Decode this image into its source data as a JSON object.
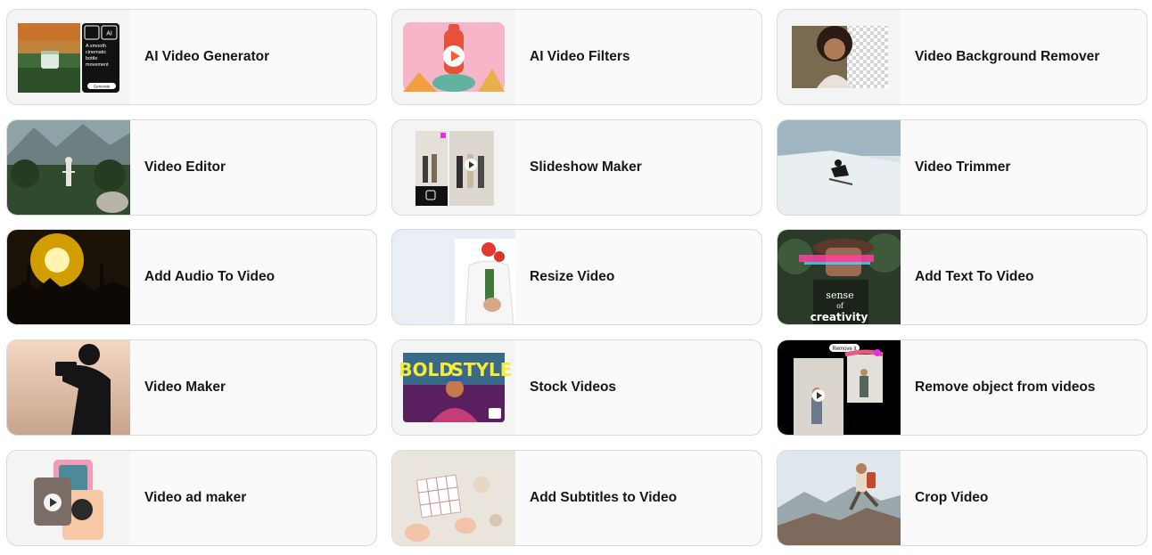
{
  "tools": [
    {
      "label": "AI Video Generator",
      "thumb": "ai-video-generator-thumbnail",
      "thumb_text": [
        "A smooth",
        "cinematic",
        "bottle",
        "movement"
      ],
      "thumb_button": "Generate",
      "thumb_badge": "AI"
    },
    {
      "label": "AI Video Filters",
      "thumb": "ai-video-filters-thumbnail"
    },
    {
      "label": "Video Background Remover",
      "thumb": "video-background-remover-thumbnail"
    },
    {
      "label": "Video Editor",
      "thumb": "video-editor-thumbnail"
    },
    {
      "label": "Slideshow Maker",
      "thumb": "slideshow-maker-thumbnail"
    },
    {
      "label": "Video Trimmer",
      "thumb": "video-trimmer-thumbnail"
    },
    {
      "label": "Add Audio To Video",
      "thumb": "add-audio-to-video-thumbnail"
    },
    {
      "label": "Resize Video",
      "thumb": "resize-video-thumbnail"
    },
    {
      "label": "Add Text To Video",
      "thumb": "add-text-to-video-thumbnail",
      "thumb_text": [
        "sense",
        "of",
        "creativity"
      ]
    },
    {
      "label": "Video Maker",
      "thumb": "video-maker-thumbnail"
    },
    {
      "label": "Stock Videos",
      "thumb": "stock-videos-thumbnail",
      "thumb_text": [
        "BOLD",
        "STYLE"
      ]
    },
    {
      "label": "Remove object from videos",
      "thumb": "remove-object-thumbnail",
      "thumb_tag": "Remove it"
    },
    {
      "label": "Video ad maker",
      "thumb": "video-ad-maker-thumbnail"
    },
    {
      "label": "Add Subtitles to Video",
      "thumb": "add-subtitles-thumbnail"
    },
    {
      "label": "Crop Video",
      "thumb": "crop-video-thumbnail"
    }
  ],
  "colors": {
    "card_border": "#d9d9d9",
    "card_bg": "#fafafa",
    "label": "#16161d",
    "play_accent": "#ff5a2c",
    "magenta_accent": "#e62ee6"
  }
}
